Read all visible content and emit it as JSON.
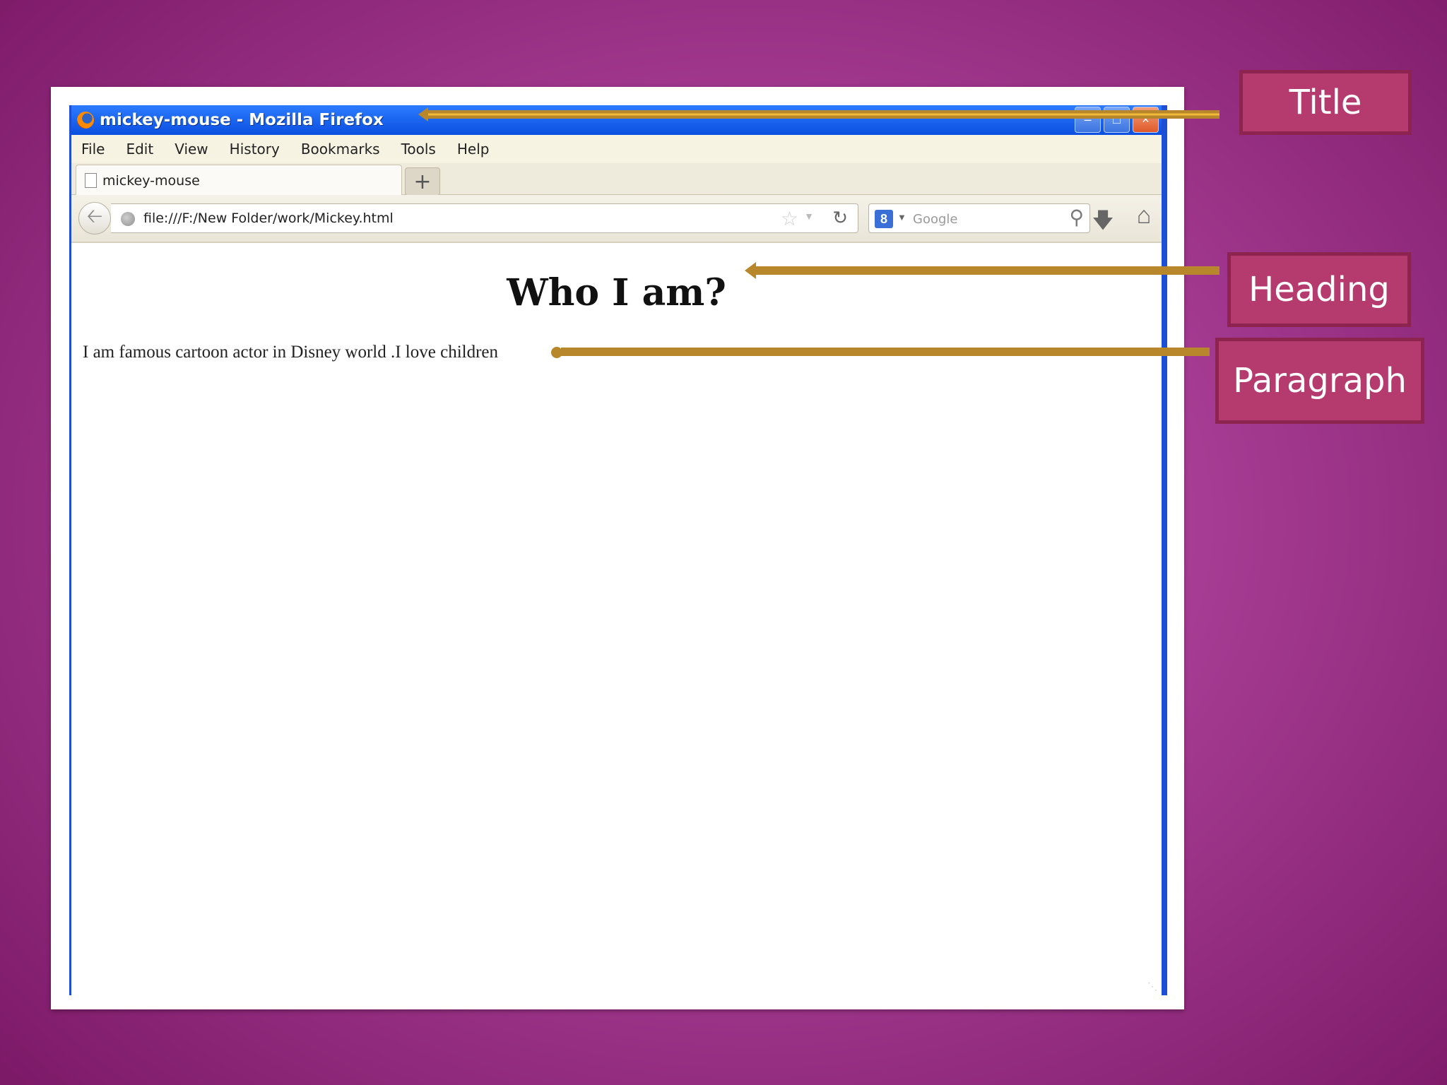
{
  "browser": {
    "window_title": "mickey-mouse - Mozilla Firefox",
    "menu": [
      "File",
      "Edit",
      "View",
      "History",
      "Bookmarks",
      "Tools",
      "Help"
    ],
    "tab_title": "mickey-mouse",
    "new_tab_label": "+",
    "url": "file:///F:/New Folder/work/Mickey.html",
    "search_placeholder": "Google",
    "search_engine_letter": "8"
  },
  "page": {
    "heading": "Who I am?",
    "paragraph": "I am famous cartoon actor in Disney world .I love children"
  },
  "callouts": {
    "title": "Title",
    "heading": "Heading",
    "paragraph": "Paragraph"
  },
  "colors": {
    "background": "#a63c93",
    "titlebar": "#0a4fe0",
    "callout_fill": "#b53a6d",
    "callout_border": "#8d2450",
    "arrow": "#b8862b"
  }
}
